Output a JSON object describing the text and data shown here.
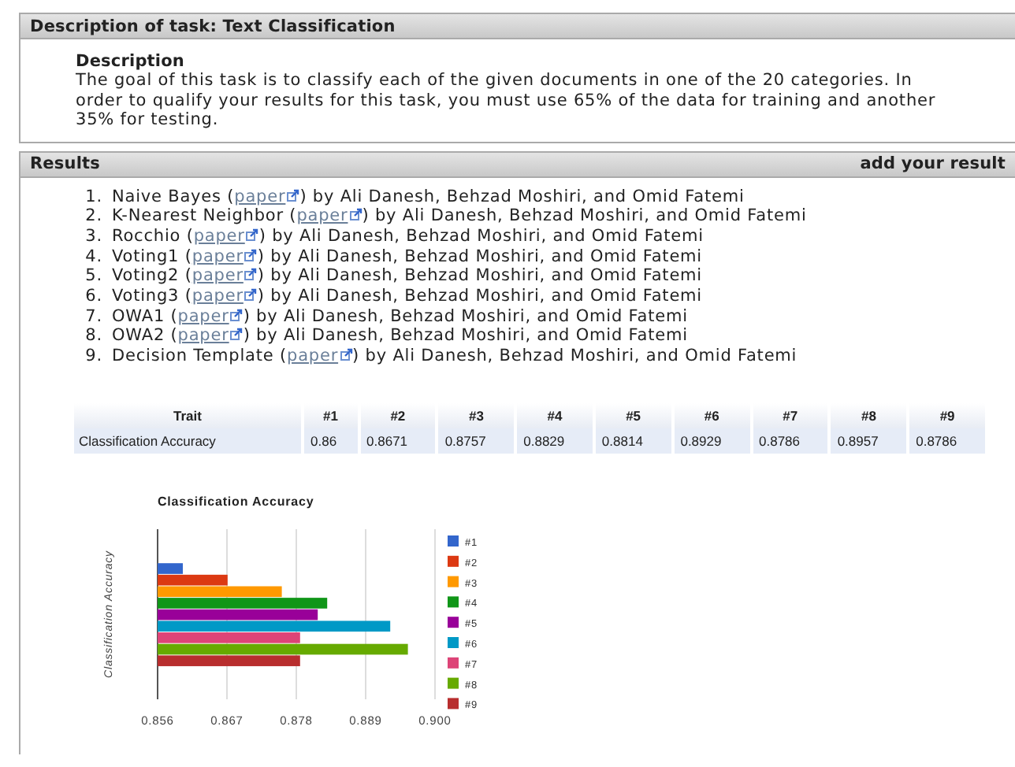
{
  "task_panel": {
    "title": "Description of task: Text Classification",
    "heading": "Description",
    "text": "The goal of this task is to classify each of the given documents in one of the 20 categories. In order to qualify your results for this task, you must use 65% of the data for training and another 35% for testing."
  },
  "results_panel": {
    "title": "Results",
    "action": "add your result",
    "items": [
      {
        "number": "1.",
        "method": "Naive Bayes (",
        "link": "paper",
        "authors": ") by Ali Danesh, Behzad Moshiri, and Omid Fatemi"
      },
      {
        "number": "2.",
        "method": "K-Nearest Neighbor (",
        "link": "paper",
        "authors": ") by Ali Danesh, Behzad Moshiri, and Omid Fatemi"
      },
      {
        "number": "3.",
        "method": "Rocchio (",
        "link": "paper",
        "authors": ") by Ali Danesh, Behzad Moshiri, and Omid Fatemi"
      },
      {
        "number": "4.",
        "method": "Voting1 (",
        "link": "paper",
        "authors": ") by Ali Danesh, Behzad Moshiri, and Omid Fatemi"
      },
      {
        "number": "5.",
        "method": "Voting2 (",
        "link": "paper",
        "authors": ") by Ali Danesh, Behzad Moshiri, and Omid Fatemi"
      },
      {
        "number": "6.",
        "method": "Voting3 (",
        "link": "paper",
        "authors": ") by Ali Danesh, Behzad Moshiri, and Omid Fatemi"
      },
      {
        "number": "7.",
        "method": "OWA1 (",
        "link": "paper",
        "authors": ") by Ali Danesh, Behzad Moshiri, and Omid Fatemi"
      },
      {
        "number": "8.",
        "method": "OWA2 (",
        "link": "paper",
        "authors": ") by Ali Danesh, Behzad Moshiri, and Omid Fatemi"
      },
      {
        "number": "9.",
        "method": "Decision Template (",
        "link": "paper",
        "authors": ") by Ali Danesh, Behzad Moshiri, and Omid Fatemi"
      }
    ],
    "table": {
      "columns": [
        "Trait",
        "#1",
        "#2",
        "#3",
        "#4",
        "#5",
        "#6",
        "#7",
        "#8",
        "#9"
      ],
      "rows": [
        [
          "Classification Accuracy",
          "0.86",
          "0.8671",
          "0.8757",
          "0.8829",
          "0.8814",
          "0.8929",
          "0.8786",
          "0.8957",
          "0.8786"
        ]
      ]
    },
    "chart_data": {
      "type": "bar",
      "orientation": "horizontal",
      "title": "Classification Accuracy",
      "ylabel": "Classification Accuracy",
      "series": [
        {
          "name": "#1",
          "color": "#3366cc",
          "values": [
            0.86
          ]
        },
        {
          "name": "#2",
          "color": "#dc3912",
          "values": [
            0.8671
          ]
        },
        {
          "name": "#3",
          "color": "#ff9900",
          "values": [
            0.8757
          ]
        },
        {
          "name": "#4",
          "color": "#109618",
          "values": [
            0.8829
          ]
        },
        {
          "name": "#5",
          "color": "#990099",
          "values": [
            0.8814
          ]
        },
        {
          "name": "#6",
          "color": "#0099c6",
          "values": [
            0.8929
          ]
        },
        {
          "name": "#7",
          "color": "#dd4477",
          "values": [
            0.8786
          ]
        },
        {
          "name": "#8",
          "color": "#66aa00",
          "values": [
            0.8957
          ]
        },
        {
          "name": "#9",
          "color": "#b82e2e",
          "values": [
            0.8786
          ]
        }
      ],
      "xlim": [
        0.856,
        0.9
      ],
      "xticks": [
        0.856,
        0.867,
        0.878,
        0.889,
        {
          "value": 0.9,
          "label": "0.900"
        }
      ],
      "grid": true,
      "legend": true
    }
  }
}
